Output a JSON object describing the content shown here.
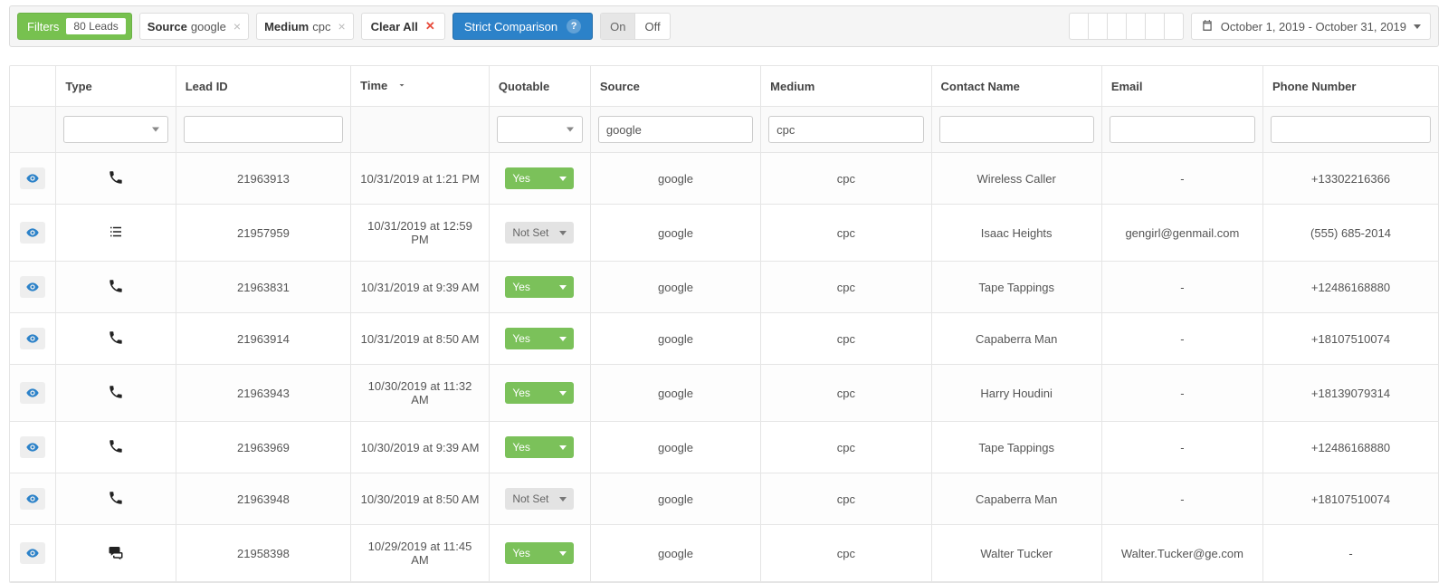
{
  "toolbar": {
    "filters_label": "Filters",
    "filters_count": "80 Leads",
    "tags": [
      {
        "label": "Source",
        "value": "google"
      },
      {
        "label": "Medium",
        "value": "cpc"
      }
    ],
    "clear_all": "Clear All",
    "strict_label": "Strict Comparison",
    "toggle_on": "On",
    "toggle_off": "Off",
    "date_range": "October 1, 2019 - October 31, 2019"
  },
  "columns": {
    "type": "Type",
    "lead_id": "Lead ID",
    "time": "Time",
    "quotable": "Quotable",
    "source": "Source",
    "medium": "Medium",
    "contact": "Contact Name",
    "email": "Email",
    "phone": "Phone Number"
  },
  "filters": {
    "source_value": "google",
    "medium_value": "cpc"
  },
  "rows": [
    {
      "type": "phone",
      "lead_id": "21963913",
      "time": "10/31/2019 at 1:21 PM",
      "quotable": "Yes",
      "source": "google",
      "medium": "cpc",
      "contact": "Wireless Caller",
      "email": "-",
      "phone": "+13302216366"
    },
    {
      "type": "form",
      "lead_id": "21957959",
      "time": "10/31/2019 at 12:59 PM",
      "quotable": "Not Set",
      "source": "google",
      "medium": "cpc",
      "contact": "Isaac Heights",
      "email": "gengirl@genmail.com",
      "phone": "(555) 685-2014"
    },
    {
      "type": "phone",
      "lead_id": "21963831",
      "time": "10/31/2019 at 9:39 AM",
      "quotable": "Yes",
      "source": "google",
      "medium": "cpc",
      "contact": "Tape Tappings",
      "email": "-",
      "phone": "+12486168880"
    },
    {
      "type": "phone",
      "lead_id": "21963914",
      "time": "10/31/2019 at 8:50 AM",
      "quotable": "Yes",
      "source": "google",
      "medium": "cpc",
      "contact": "Capaberra Man",
      "email": "-",
      "phone": "+18107510074"
    },
    {
      "type": "phone",
      "lead_id": "21963943",
      "time": "10/30/2019 at 11:32 AM",
      "quotable": "Yes",
      "source": "google",
      "medium": "cpc",
      "contact": "Harry Houdini",
      "email": "-",
      "phone": "+18139079314"
    },
    {
      "type": "phone",
      "lead_id": "21963969",
      "time": "10/30/2019 at 9:39 AM",
      "quotable": "Yes",
      "source": "google",
      "medium": "cpc",
      "contact": "Tape Tappings",
      "email": "-",
      "phone": "+12486168880"
    },
    {
      "type": "phone",
      "lead_id": "21963948",
      "time": "10/30/2019 at 8:50 AM",
      "quotable": "Not Set",
      "source": "google",
      "medium": "cpc",
      "contact": "Capaberra Man",
      "email": "-",
      "phone": "+18107510074"
    },
    {
      "type": "chat",
      "lead_id": "21958398",
      "time": "10/29/2019 at 11:45 AM",
      "quotable": "Yes",
      "source": "google",
      "medium": "cpc",
      "contact": "Walter Tucker",
      "email": "Walter.Tucker@ge.com",
      "phone": "-"
    }
  ]
}
